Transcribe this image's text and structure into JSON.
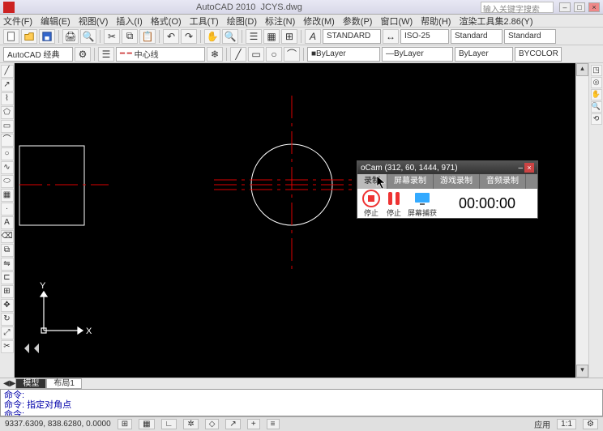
{
  "title": {
    "app": "AutoCAD 2010",
    "file": "JCYS.dwg",
    "search_placeholder": "输入关键字搜索"
  },
  "menu": [
    "文件(F)",
    "编辑(E)",
    "视图(V)",
    "插入(I)",
    "格式(O)",
    "工具(T)",
    "绘图(D)",
    "标注(N)",
    "修改(M)",
    "参数(P)",
    "窗口(W)",
    "帮助(H)",
    "渲染工具集2.86(Y)"
  ],
  "toolbar": {
    "style_text": "STANDARD",
    "style_dim": "ISO-25",
    "style_std": "Standard",
    "style_std2": "Standard",
    "workspace": "AutoCAD 经典",
    "linetype": "中心线",
    "layer": "ByLayer",
    "color": "ByLayer",
    "lw": "ByLayer",
    "plot": "BYCOLOR"
  },
  "canvas": {
    "ucs_x": "X",
    "ucs_y": "Y"
  },
  "tabs": [
    "模型",
    "布局1"
  ],
  "cmd": {
    "line1": "命令:",
    "line2": "命令: 指定对角点",
    "line3": "命令:"
  },
  "status": {
    "coords": "9337.6309, 838.6280, 0.0000",
    "scale": "1:1",
    "app": "应用"
  },
  "ocam": {
    "title": "oCam (312, 60, 1444, 971)",
    "tabs": [
      "录制",
      "屏幕录制",
      "游戏录制",
      "音频录制"
    ],
    "btn_stop": "停止",
    "btn_pause": "停止",
    "btn_capture": "屏幕捕获",
    "timer": "00:00:00"
  },
  "chart_data": null
}
